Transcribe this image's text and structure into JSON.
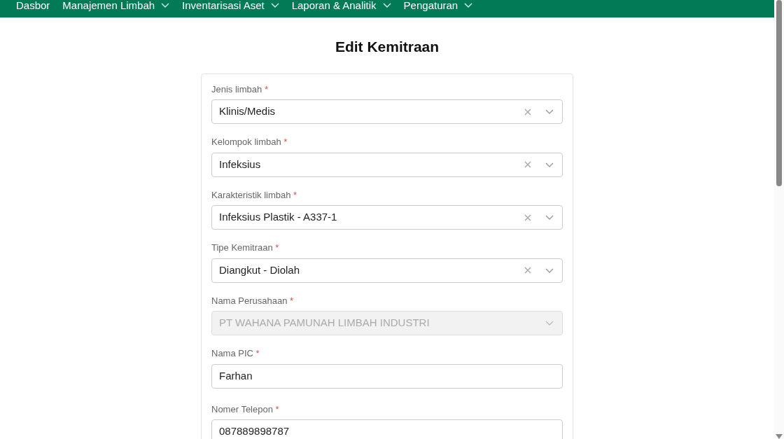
{
  "nav": [
    {
      "label": "Dasbor",
      "dropdown": false
    },
    {
      "label": "Manajemen Limbah",
      "dropdown": true
    },
    {
      "label": "Inventarisasi Aset",
      "dropdown": true
    },
    {
      "label": "Laporan & Analitik",
      "dropdown": true
    },
    {
      "label": "Pengaturan",
      "dropdown": true
    }
  ],
  "title": "Edit Kemitraan",
  "fields": [
    {
      "label": "Jenis limbah",
      "required": "*",
      "kind": "select",
      "value": "Klinis/Medis",
      "disabled": false
    },
    {
      "label": "Kelompok limbah",
      "required": "*",
      "kind": "select",
      "value": "Infeksius",
      "disabled": false
    },
    {
      "label": "Karakteristik limbah",
      "required": "*",
      "kind": "select",
      "value": "Infeksius Plastik - A337-1",
      "disabled": false
    },
    {
      "label": "Tipe Kemitraan",
      "required": "*",
      "kind": "select",
      "value": "Diangkut - Diolah",
      "disabled": false
    },
    {
      "label": "Nama Perusahaan",
      "required": "*",
      "kind": "select",
      "value": "PT WAHANA PAMUNAH LIMBAH INDUSTRI",
      "disabled": true
    },
    {
      "label": "Nama PIC",
      "required": "*",
      "kind": "input",
      "value": "Farhan",
      "disabled": false
    },
    {
      "label": "Nomer Telepon",
      "required": "*",
      "kind": "input",
      "value": "087889898787",
      "disabled": false
    }
  ]
}
